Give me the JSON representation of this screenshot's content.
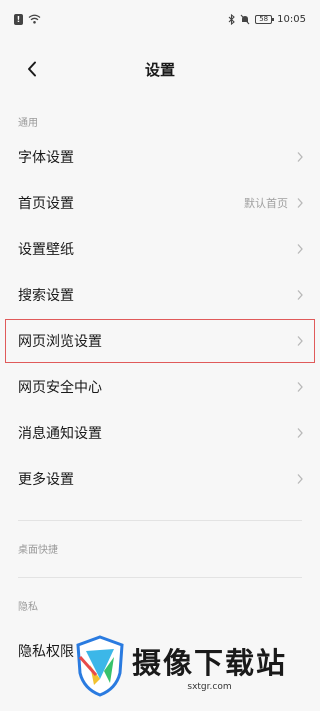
{
  "status_bar": {
    "time": "10:05",
    "battery": "58"
  },
  "header": {
    "title": "设置"
  },
  "sections": {
    "general_label": "通用",
    "desktop_label": "桌面快捷",
    "privacy_label": "隐私"
  },
  "general_items": [
    {
      "label": "字体设置",
      "value": ""
    },
    {
      "label": "首页设置",
      "value": "默认首页"
    },
    {
      "label": "设置壁纸",
      "value": ""
    },
    {
      "label": "搜索设置",
      "value": ""
    },
    {
      "label": "网页浏览设置",
      "value": ""
    },
    {
      "label": "网页安全中心",
      "value": ""
    },
    {
      "label": "消息通知设置",
      "value": ""
    },
    {
      "label": "更多设置",
      "value": ""
    }
  ],
  "privacy_items": [
    {
      "label": "隐私权限"
    }
  ],
  "watermark": {
    "title": "摄像下载站",
    "url": "sxtgr.com"
  },
  "colors": {
    "highlight": "#e05a5a",
    "background": "#f7f7f7"
  }
}
